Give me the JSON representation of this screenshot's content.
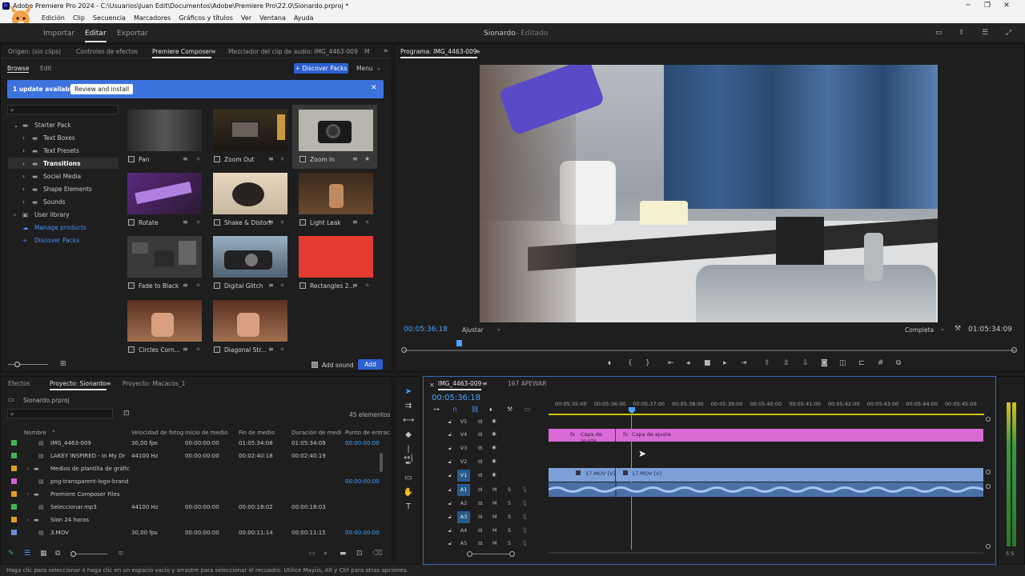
{
  "window": {
    "title": "Adobe Premiere Pro 2024 - C:\\Usuarios\\Juan Edit\\Documentos\\Adobe\\Premiere Pro\\22.0\\Sionardo.prproj *",
    "minimize": "─",
    "maximize": "❐",
    "close": "✕"
  },
  "menu": [
    "Archivo",
    "Edición",
    "Clip",
    "Secuencia",
    "Marcadores",
    "Gráficos y títulos",
    "Ver",
    "Ventana",
    "Ayuda"
  ],
  "workspace": {
    "tabs": [
      "Importar",
      "Editar",
      "Exportar"
    ],
    "active": "Editar",
    "project_name": "Sionardo",
    "project_status": "- Editado"
  },
  "source_panel": {
    "tabs": [
      "Origen: (sin clips)",
      "Controles de efectos",
      "Premiere Composer",
      "Mezclador del clip de audio: IMG_4463-009",
      "M"
    ]
  },
  "composer": {
    "subtabs": [
      "Browse",
      "Edit"
    ],
    "discover_button": "+ Discover Packs",
    "menu_label": "Menu",
    "banner_text": "1 update available",
    "banner_button": "Review and install",
    "tree": [
      "Starter Pack",
      "Text Boxes",
      "Text Presets",
      "Transitions",
      "Social Media",
      "Shape Elements",
      "Sounds",
      "User library",
      "Manage products",
      "Discover Packs"
    ],
    "thumbs": [
      "Pan",
      "Zoom Out",
      "Zoom In",
      "Rotate",
      "Shake & Distort",
      "Light Leak",
      "Fade to Black",
      "Digital Glitch",
      "Rectangles 2...",
      "Circles Corn...",
      "Diagonal Str..."
    ],
    "add_sound": "Add sound",
    "add_button": "Add"
  },
  "program": {
    "title": "Programa: IMG_4463-009",
    "timecode": "00:05:36:18",
    "fit": "Ajustar",
    "quality": "Completa",
    "duration": "01:05:34:09",
    "playhead_fraction": 0.09
  },
  "project": {
    "tabs": [
      "Efectos",
      "Proyecto: Sionardo",
      "Proyecto: Macacos_1"
    ],
    "file": "Sionardo.prproj",
    "count": "45 elementos",
    "columns": [
      "Nombre",
      "Velocidad de fotog",
      "Inicio de medio",
      "Fin de medio",
      "Duración de medi",
      "Punto de entrac"
    ],
    "rows": [
      {
        "name": "IMG_4463-009",
        "fps": "30,00 fps",
        "start": "00:00:00:00",
        "end": "01:05:34:08",
        "dur": "01:05:34:09",
        "in": "00:00:00:00",
        "color": "#3fb55a"
      },
      {
        "name": "LAKEY INSPIRED - In My Dr",
        "fps": "44100 Hz",
        "start": "00:00:00:00",
        "end": "00:02:40:18",
        "dur": "00:02:40:19",
        "in": "",
        "color": "#3fb55a"
      },
      {
        "name": "Medios de plantilla de gráfic",
        "fps": "",
        "start": "",
        "end": "",
        "dur": "",
        "in": "",
        "color": "#e0a020"
      },
      {
        "name": "png-transparent-logo-brand",
        "fps": "",
        "start": "",
        "end": "",
        "dur": "",
        "in": "00:00:00:00",
        "color": "#d05fd0"
      },
      {
        "name": "Premiere Composer Files",
        "fps": "",
        "start": "",
        "end": "",
        "dur": "",
        "in": "",
        "color": "#e0a020"
      },
      {
        "name": "Seleccionar.mp3",
        "fps": "44100 Hz",
        "start": "00:00:00:00",
        "end": "00:00:18:02",
        "dur": "00:00:18:03",
        "in": "",
        "color": "#3fb55a"
      },
      {
        "name": "Sion 24 horas",
        "fps": "",
        "start": "",
        "end": "",
        "dur": "",
        "in": "",
        "color": "#e0a020"
      },
      {
        "name": "3.MOV",
        "fps": "30,00 fps",
        "start": "00:00:00:00",
        "end": "00:00:11:14",
        "dur": "00:00:11:15",
        "in": "00:00:00:00",
        "color": "#6a8ad8"
      }
    ]
  },
  "timeline": {
    "tabs": [
      "IMG_4463-009",
      "167 APEWAR"
    ],
    "timecode": "00:05:36:18",
    "ruler": [
      "00:05:35:00",
      "00:05:36:00",
      "00:05:37:00",
      "00:05:38:00",
      "00:05:39:00",
      "00:05:40:00",
      "00:05:41:00",
      "00:05:42:00",
      "00:05:43:00",
      "00:05:44:00",
      "00:05:45:00"
    ],
    "video_tracks": [
      "V5",
      "V4",
      "V3",
      "V2",
      "V1"
    ],
    "audio_tracks": [
      "A1",
      "A2",
      "A3",
      "A4",
      "A5"
    ],
    "adj1": "Capa de ajuste",
    "adj2": "Capa de ajuste",
    "clip1": "17.MOV [V]",
    "clip2": "17.MOV [V]",
    "m_label": "M",
    "s_label": "S",
    "fx": "fx",
    "meter_label": "S S"
  },
  "status": "Haga clic para seleccionar o haga clic en un espacio vacío y arrastre para seleccionar el recuadro. Utilice Mayús, Alt y Ctrl para otras opciones."
}
